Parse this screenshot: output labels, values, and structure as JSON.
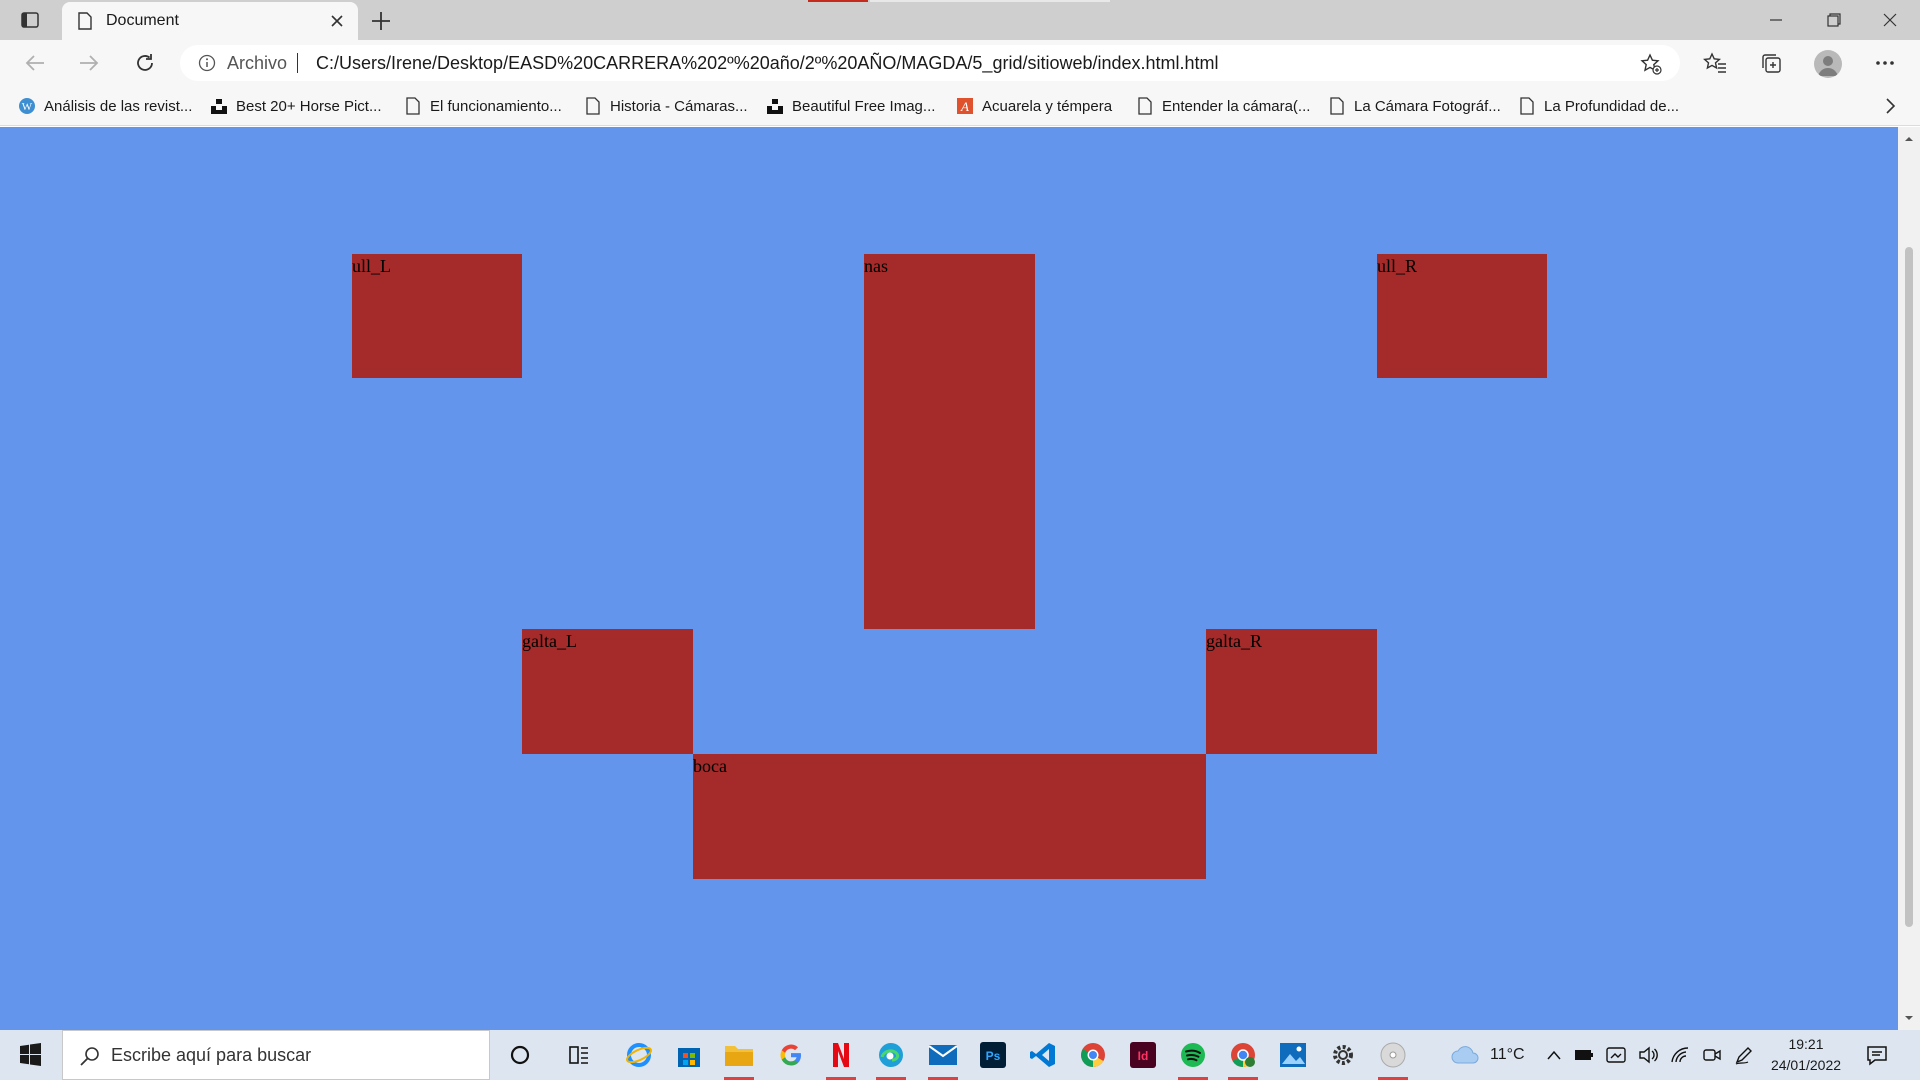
{
  "browser": {
    "tab_title": "Document",
    "address_scheme": "Archivo",
    "url": "C:/Users/Irene/Desktop/EASD%20CARRERA%202º%20año/2º%20AÑO/MAGDA/5_grid/sitioweb/index.html.html"
  },
  "bookmarks": [
    {
      "label": "Análisis de las revist...",
      "icon": "wordpress-icon"
    },
    {
      "label": "Best 20+ Horse Pict...",
      "icon": "unsplash-icon"
    },
    {
      "label": "El funcionamiento...",
      "icon": "page-icon"
    },
    {
      "label": "Historia - Cámaras...",
      "icon": "page-icon"
    },
    {
      "label": "Beautiful Free Imag...",
      "icon": "unsplash-icon"
    },
    {
      "label": "Acuarela y témpera",
      "icon": "art-icon"
    },
    {
      "label": "Entender la cámara(...",
      "icon": "page-icon"
    },
    {
      "label": "La Cámara Fotográf...",
      "icon": "page-icon"
    },
    {
      "label": "La Profundidad de...",
      "icon": "page-icon"
    }
  ],
  "page": {
    "background": "#6495ed",
    "item_color": "#a52a2a",
    "items": {
      "ull_l": "ull_L",
      "nas": "nas",
      "ull_r": "ull_R",
      "galta_l": "galta_L",
      "galta_r": "galta_R",
      "boca": "boca"
    }
  },
  "taskbar": {
    "search_placeholder": "Escribe aquí para buscar",
    "apps": [
      "cortana",
      "task-view",
      "internet-explorer",
      "store",
      "file-explorer",
      "google",
      "netflix",
      "edge",
      "mail",
      "photoshop",
      "vscode",
      "chrome",
      "indesign",
      "spotify",
      "chrome-profile",
      "photos",
      "settings",
      "dvd"
    ],
    "weather_temp": "11°C",
    "time": "19:21",
    "date": "24/01/2022"
  }
}
